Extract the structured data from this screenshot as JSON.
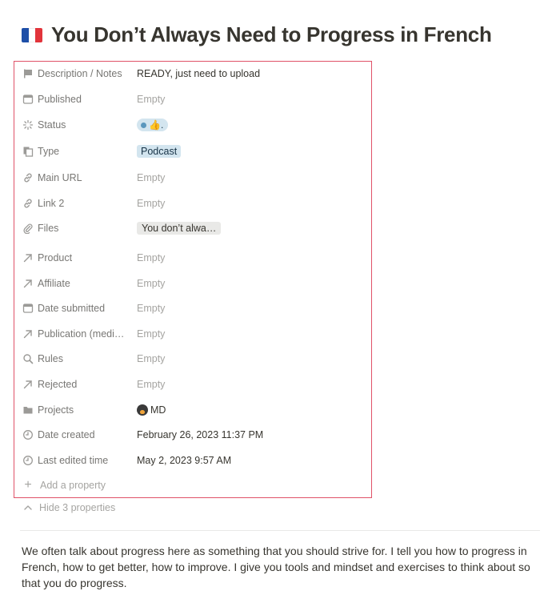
{
  "page": {
    "title": "You Don’t Always Need to Progress in French",
    "title_icon": "french-flag-icon",
    "flag_colors": [
      "#1e4fa8",
      "#ffffff",
      "#e2343b"
    ]
  },
  "properties": [
    {
      "icon": "notes-flag-icon",
      "label": "Description / Notes",
      "value": "READY, just need to upload",
      "empty": false
    },
    {
      "icon": "calendar-icon",
      "label": "Published",
      "value": "Empty",
      "empty": true
    },
    {
      "icon": "status-icon",
      "label": "Status",
      "value": "",
      "status_emoji": "👍.",
      "empty": false
    },
    {
      "icon": "type-icon",
      "label": "Type",
      "value": "Podcast",
      "empty": false
    },
    {
      "icon": "link-icon",
      "label": "Main URL",
      "value": "Empty",
      "empty": true
    },
    {
      "icon": "link-icon",
      "label": "Link 2",
      "value": "Empty",
      "empty": true
    },
    {
      "icon": "paperclip-icon",
      "label": "Files",
      "value": "You don’t alwa…",
      "empty": false
    },
    {
      "icon": "relation-arrow-icon",
      "label": "Product",
      "value": "Empty",
      "empty": true
    },
    {
      "icon": "relation-arrow-icon",
      "label": "Affiliate",
      "value": "Empty",
      "empty": true
    },
    {
      "icon": "calendar-icon",
      "label": "Date submitted",
      "value": "Empty",
      "empty": true
    },
    {
      "icon": "relation-arrow-icon",
      "label": "Publication (medi…",
      "value": "Empty",
      "empty": true
    },
    {
      "icon": "search-icon",
      "label": "Rules",
      "value": "Empty",
      "empty": true
    },
    {
      "icon": "relation-arrow-icon",
      "label": "Rejected",
      "value": "Empty",
      "empty": true
    },
    {
      "icon": "folder-icon",
      "label": "Projects",
      "value": "MD",
      "empty": false
    },
    {
      "icon": "clock-icon",
      "label": "Date created",
      "value": "February 26, 2023 11:37 PM",
      "empty": false
    },
    {
      "icon": "clock-icon",
      "label": "Last edited time",
      "value": "May 2, 2023 9:57 AM",
      "empty": false
    }
  ],
  "add_property_label": "Add a property",
  "hide_properties_label": "Hide 3 properties",
  "body_text": "We often talk about progress here as something that you should strive for. I tell you how to progress in French, how to get better, how to improve. I give you tools and mindset and exercises to think about so that you do progress.",
  "colors": {
    "highlight_border": "#e05268",
    "tag_blue": "#d3e5ef",
    "muted_text": "#a5a4a1",
    "label_text": "#787774"
  }
}
